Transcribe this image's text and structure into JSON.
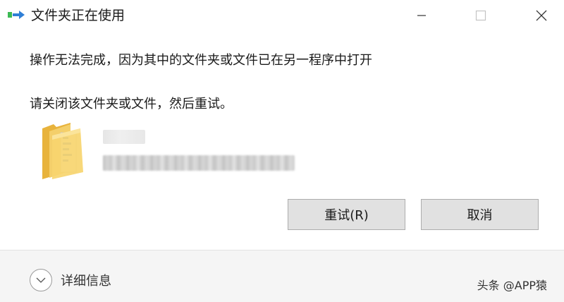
{
  "window": {
    "title": "文件夹正在使用",
    "icon": "file-move-icon"
  },
  "message": {
    "line1": "操作无法完成，因为其中的文件夹或文件已在另一程序中打开",
    "line2": "请关闭该文件夹或文件，然后重试。"
  },
  "file": {
    "icon": "folder-icon"
  },
  "buttons": {
    "retry_label": "重试(R)",
    "cancel_label": "取消"
  },
  "footer": {
    "details_label": "详细信息",
    "watermark": "头条 @APP猿"
  },
  "colors": {
    "button_bg": "#e1e1e1",
    "button_border": "#adadad",
    "footer_bg": "#f5f5f5",
    "folder_yellow": "#f2c14e"
  }
}
